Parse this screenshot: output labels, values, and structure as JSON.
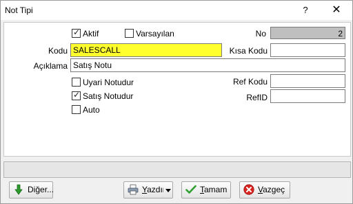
{
  "window": {
    "title": "Not Tipi",
    "help_label": "?",
    "close_label": "✕"
  },
  "form": {
    "aktif": {
      "label": "Aktif",
      "checked": true
    },
    "varsayilan": {
      "label": "Varsayılan",
      "checked": false
    },
    "no": {
      "label": "No",
      "value": "2"
    },
    "kodu": {
      "label": "Kodu",
      "value": "SALESCALL"
    },
    "kisa_kodu": {
      "label": "Kısa Kodu",
      "value": ""
    },
    "aciklama": {
      "label": "Açıklama",
      "value": "Satış Notu"
    },
    "uyari_notudur": {
      "label": "Uyari Notudur",
      "checked": false
    },
    "satis_notudur": {
      "label": "Satış Notudur",
      "checked": true
    },
    "auto": {
      "label": "Auto",
      "checked": false
    },
    "ref_kodu": {
      "label": "Ref Kodu",
      "value": ""
    },
    "refid": {
      "label": "RefID",
      "value": ""
    }
  },
  "statusbar": {
    "text": ""
  },
  "buttons": {
    "diger": "Diğer...",
    "yazdir": "Yazdır",
    "tamam": "Tamam",
    "vazgec": "Vazgeç"
  },
  "colors": {
    "highlight_field": "#ffff2e",
    "readonly_field": "#bfbfbf"
  },
  "icons": [
    "down-arrow-icon",
    "print-icon",
    "checkmark-icon",
    "cancel-icon",
    "dropdown-arrow-icon",
    "check-icon"
  ]
}
